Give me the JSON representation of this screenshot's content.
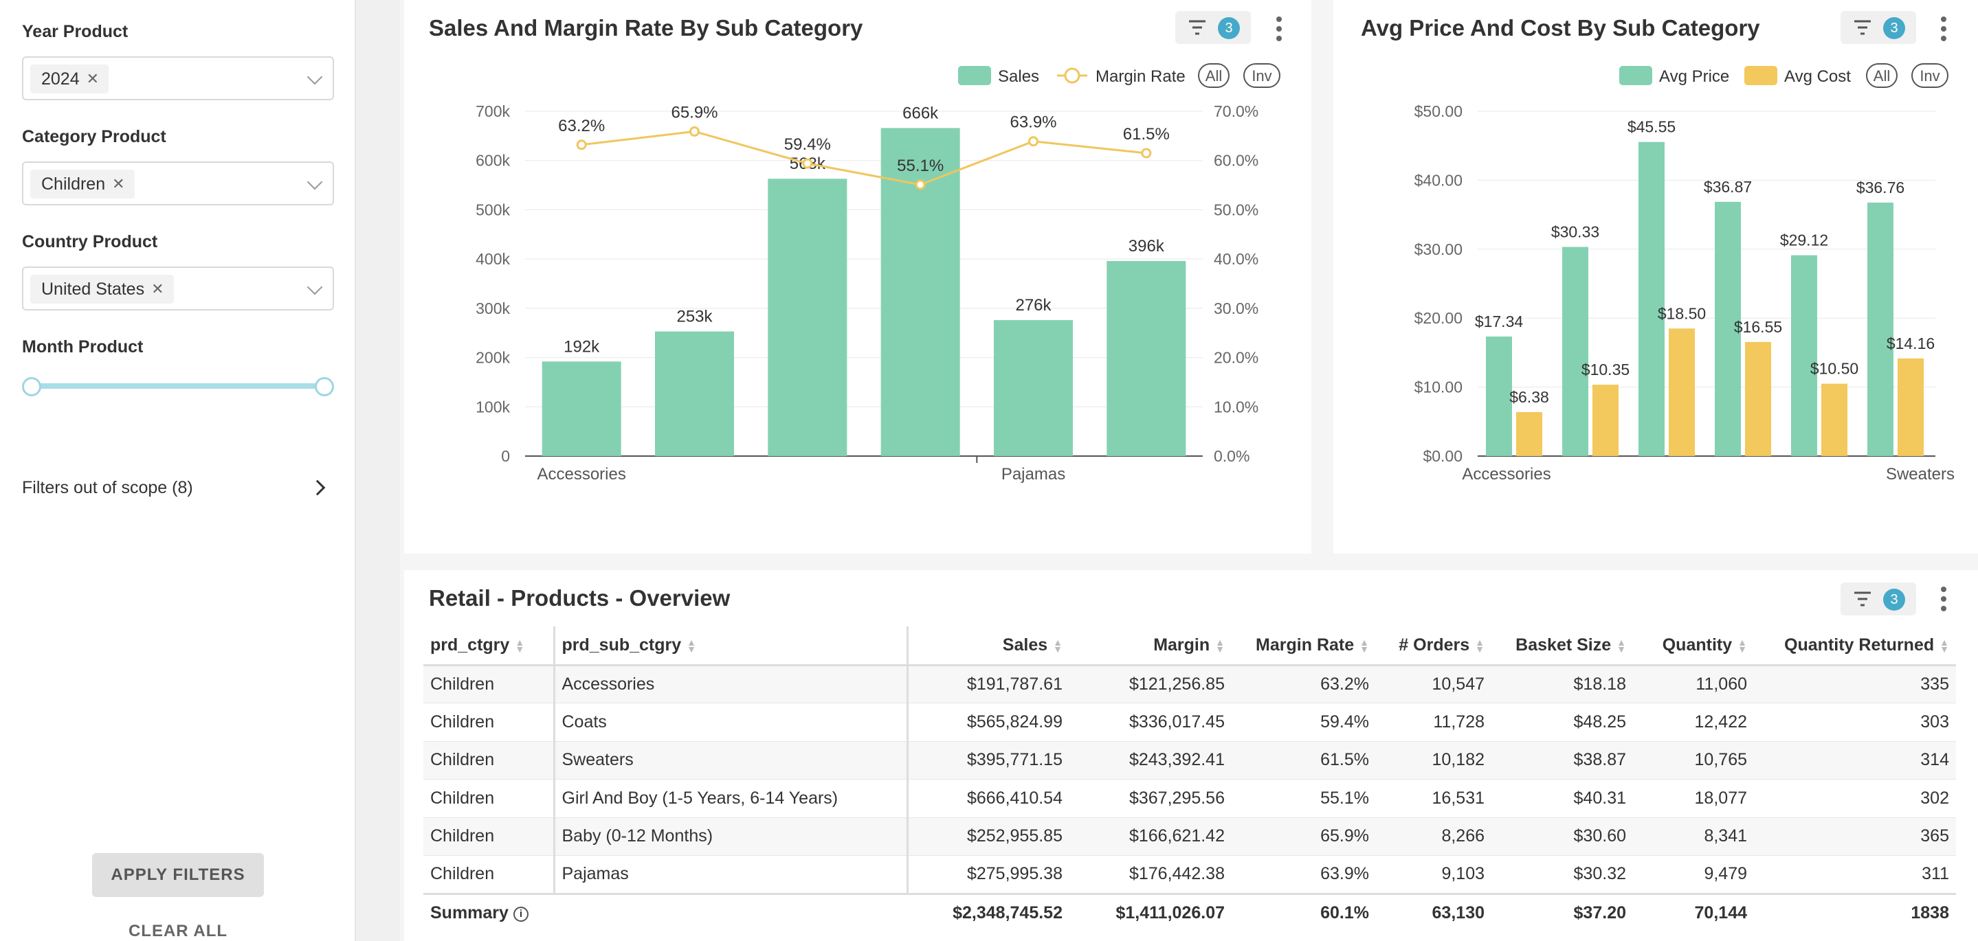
{
  "filters": {
    "year": {
      "label": "Year Product",
      "value": "2024"
    },
    "category": {
      "label": "Category Product",
      "value": "Children"
    },
    "country": {
      "label": "Country Product",
      "value": "United States"
    },
    "month": {
      "label": "Month Product"
    },
    "out_of_scope": "Filters out of scope (8)",
    "apply_label": "APPLY FILTERS",
    "clear_label": "CLEAR ALL"
  },
  "colors": {
    "green": "#84d1b2",
    "yellow": "#f3c85c",
    "line": "#f0c65e",
    "badge": "#45a9c9"
  },
  "chart1": {
    "title": "Sales And Margin Rate By Sub Category",
    "filter_count": "3",
    "legend": {
      "sales": "Sales",
      "margin": "Margin Rate",
      "all": "All",
      "inv": "Inv"
    }
  },
  "chart2": {
    "title": "Avg Price And Cost By Sub Category",
    "filter_count": "3",
    "legend": {
      "price": "Avg Price",
      "cost": "Avg Cost",
      "all": "All",
      "inv": "Inv"
    }
  },
  "table": {
    "title": "Retail - Products - Overview",
    "filter_count": "3",
    "headers": [
      "prd_ctgry",
      "prd_sub_ctgry",
      "Sales",
      "Margin",
      "Margin Rate",
      "# Orders",
      "Basket Size",
      "Quantity",
      "Quantity Returned"
    ],
    "rows": [
      [
        "Children",
        "Accessories",
        "$191,787.61",
        "$121,256.85",
        "63.2%",
        "10,547",
        "$18.18",
        "11,060",
        "335"
      ],
      [
        "Children",
        "Coats",
        "$565,824.99",
        "$336,017.45",
        "59.4%",
        "11,728",
        "$48.25",
        "12,422",
        "303"
      ],
      [
        "Children",
        "Sweaters",
        "$395,771.15",
        "$243,392.41",
        "61.5%",
        "10,182",
        "$38.87",
        "10,765",
        "314"
      ],
      [
        "Children",
        "Girl And Boy (1-5 Years, 6-14 Years)",
        "$666,410.54",
        "$367,295.56",
        "55.1%",
        "16,531",
        "$40.31",
        "18,077",
        "302"
      ],
      [
        "Children",
        "Baby (0-12 Months)",
        "$252,955.85",
        "$166,621.42",
        "65.9%",
        "8,266",
        "$30.60",
        "8,341",
        "365"
      ],
      [
        "Children",
        "Pajamas",
        "$275,995.38",
        "$176,442.38",
        "63.9%",
        "9,103",
        "$30.32",
        "9,479",
        "311"
      ]
    ],
    "summary": [
      "Summary",
      "",
      "$2,348,745.52",
      "$1,411,026.07",
      "60.1%",
      "63,130",
      "$37.20",
      "70,144",
      "1838"
    ]
  },
  "chart_data": [
    {
      "type": "bar",
      "title": "Sales And Margin Rate By Sub Category",
      "categories": [
        "Accessories",
        "Baby (0-12 Months)",
        "Coats",
        "Girl And Boy (1-5 Years, 6-14 Years)",
        "Pajamas",
        "Sweaters"
      ],
      "x_tick_labels_visible": [
        "Accessories",
        "Pajamas"
      ],
      "series": [
        {
          "name": "Sales",
          "type": "bar",
          "values": [
            192000,
            253000,
            563000,
            666000,
            276000,
            396000
          ],
          "labels": [
            "192k",
            "253k",
            "563k",
            "666k",
            "276k",
            "396k"
          ]
        },
        {
          "name": "Margin Rate",
          "type": "line",
          "axis": "right",
          "values": [
            63.2,
            65.9,
            59.4,
            55.1,
            63.9,
            61.5
          ],
          "labels": [
            "63.2%",
            "65.9%",
            "59.4%",
            "55.1%",
            "63.9%",
            "61.5%"
          ]
        }
      ],
      "ylim": [
        0,
        700000
      ],
      "yticks": [
        "0",
        "100k",
        "200k",
        "300k",
        "400k",
        "500k",
        "600k",
        "700k"
      ],
      "y2lim": [
        0,
        70
      ],
      "y2ticks": [
        "0.0%",
        "10.0%",
        "20.0%",
        "30.0%",
        "40.0%",
        "50.0%",
        "60.0%",
        "70.0%"
      ],
      "grid": true,
      "legend": "top-right"
    },
    {
      "type": "bar",
      "title": "Avg Price And Cost By Sub Category",
      "categories": [
        "Accessories",
        "Baby (0-12 Months)",
        "Coats",
        "Girl And Boy (1-5 Years, 6-14 Years)",
        "Pajamas",
        "Sweaters"
      ],
      "x_tick_labels_visible": [
        "Accessories",
        "Sweaters"
      ],
      "series": [
        {
          "name": "Avg Price",
          "values": [
            17.34,
            30.33,
            45.55,
            36.87,
            29.12,
            36.76
          ],
          "labels": [
            "$17.34",
            "$30.33",
            "$45.55",
            "$36.87",
            "$29.12",
            "$36.76"
          ]
        },
        {
          "name": "Avg Cost",
          "values": [
            6.38,
            10.35,
            18.5,
            16.55,
            10.5,
            14.16
          ],
          "labels": [
            "$6.38",
            "$10.35",
            "$18.50",
            "$16.55",
            "$10.50",
            "$14.16"
          ]
        }
      ],
      "ylim": [
        0,
        50
      ],
      "yticks": [
        "$0.00",
        "$10.00",
        "$20.00",
        "$30.00",
        "$40.00",
        "$50.00"
      ],
      "grid": true,
      "legend": "top-right"
    }
  ]
}
